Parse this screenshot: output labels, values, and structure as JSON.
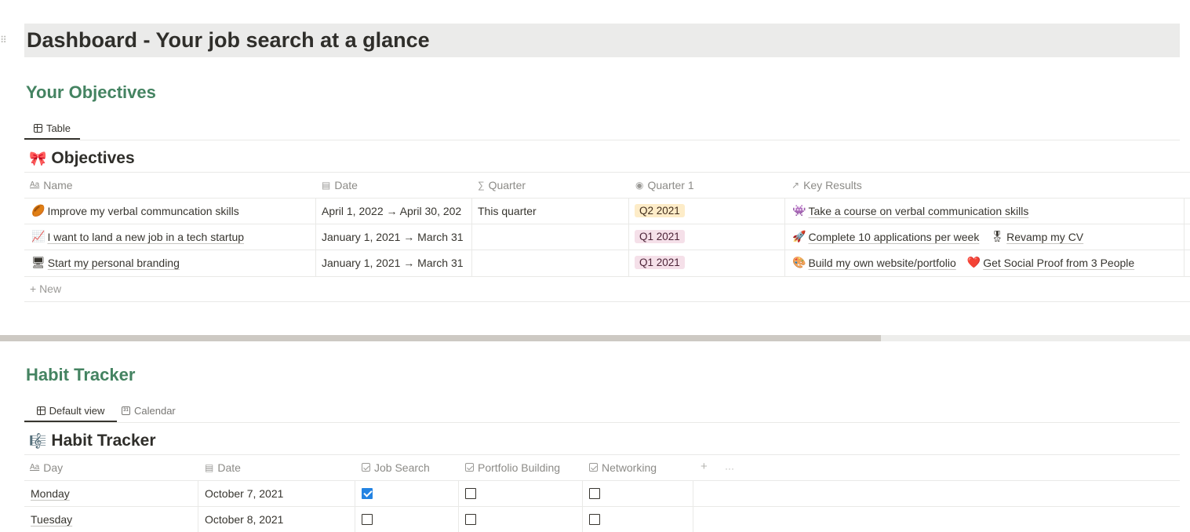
{
  "page": {
    "title": "Dashboard - Your job search at a glance",
    "drag_handle": "⠿"
  },
  "objectives_section": {
    "heading": "Your Objectives",
    "tabs": [
      {
        "label": "Table",
        "icon": "table-icon",
        "active": true
      }
    ],
    "database": {
      "emoji": "🎀",
      "title": "Objectives",
      "columns": [
        {
          "label": "Name",
          "icon": "Aa"
        },
        {
          "label": "Date",
          "icon": "calendar-icon"
        },
        {
          "label": "Quarter",
          "icon": "∑"
        },
        {
          "label": "Quarter 1",
          "icon": "select-icon"
        },
        {
          "label": "Key Results",
          "icon": "↗"
        }
      ],
      "rows": [
        {
          "emoji": "🏉",
          "name": "Improve my verbal communcation skills",
          "date": "April 1, 2022 → April 30, 202",
          "quarter": "This quarter",
          "quarter1": "Q2 2021",
          "quarter1_color": "#fdecc8",
          "key_results": [
            {
              "emoji": "👾",
              "label": "Take a course on verbal communication skills"
            }
          ]
        },
        {
          "emoji": "📈",
          "name": "I want to land a new job in a tech startup",
          "date": "January 1, 2021 → March 31",
          "quarter": "",
          "quarter1": "Q1 2021",
          "quarter1_color": "#f5e0e9",
          "key_results": [
            {
              "emoji": "🚀",
              "label": "Complete 10 applications per week"
            },
            {
              "emoji": "🎖",
              "label": "Revamp my CV"
            }
          ]
        },
        {
          "emoji": "🖥",
          "name": "Start my personal branding",
          "date": "January 1, 2021 → March 31",
          "quarter": "",
          "quarter1": "Q1 2021",
          "quarter1_color": "#f5e0e9",
          "key_results": [
            {
              "emoji": "🎨",
              "label": "Build my own website/portfolio"
            },
            {
              "emoji": "❤️",
              "label": "Get Social Proof from 3 People"
            }
          ]
        }
      ],
      "new_label": "+ New"
    }
  },
  "habit_section": {
    "heading": "Habit Tracker",
    "tabs": [
      {
        "label": "Default view",
        "icon": "table-icon",
        "active": true
      },
      {
        "label": "Calendar",
        "icon": "calendar-icon",
        "active": false
      }
    ],
    "database": {
      "emoji": "🎼",
      "title": "Habit Tracker",
      "columns": [
        {
          "label": "Day",
          "icon": "Aa"
        },
        {
          "label": "Date",
          "icon": "calendar-icon"
        },
        {
          "label": "Job Search",
          "icon": "checkbox-icon"
        },
        {
          "label": "Portfolio Building",
          "icon": "checkbox-icon"
        },
        {
          "label": "Networking",
          "icon": "checkbox-icon"
        }
      ],
      "add_column": "+",
      "more_options": "···",
      "rows": [
        {
          "day": "Monday",
          "date": "October 7, 2021",
          "job_search": true,
          "portfolio": false,
          "networking": false
        },
        {
          "day": "Tuesday",
          "date": "October 8, 2021",
          "job_search": false,
          "portfolio": false,
          "networking": false
        }
      ]
    }
  },
  "colors": {
    "section_heading": "#448361",
    "checkbox_checked": "#2383e2",
    "title_bar": "#ebebea"
  }
}
